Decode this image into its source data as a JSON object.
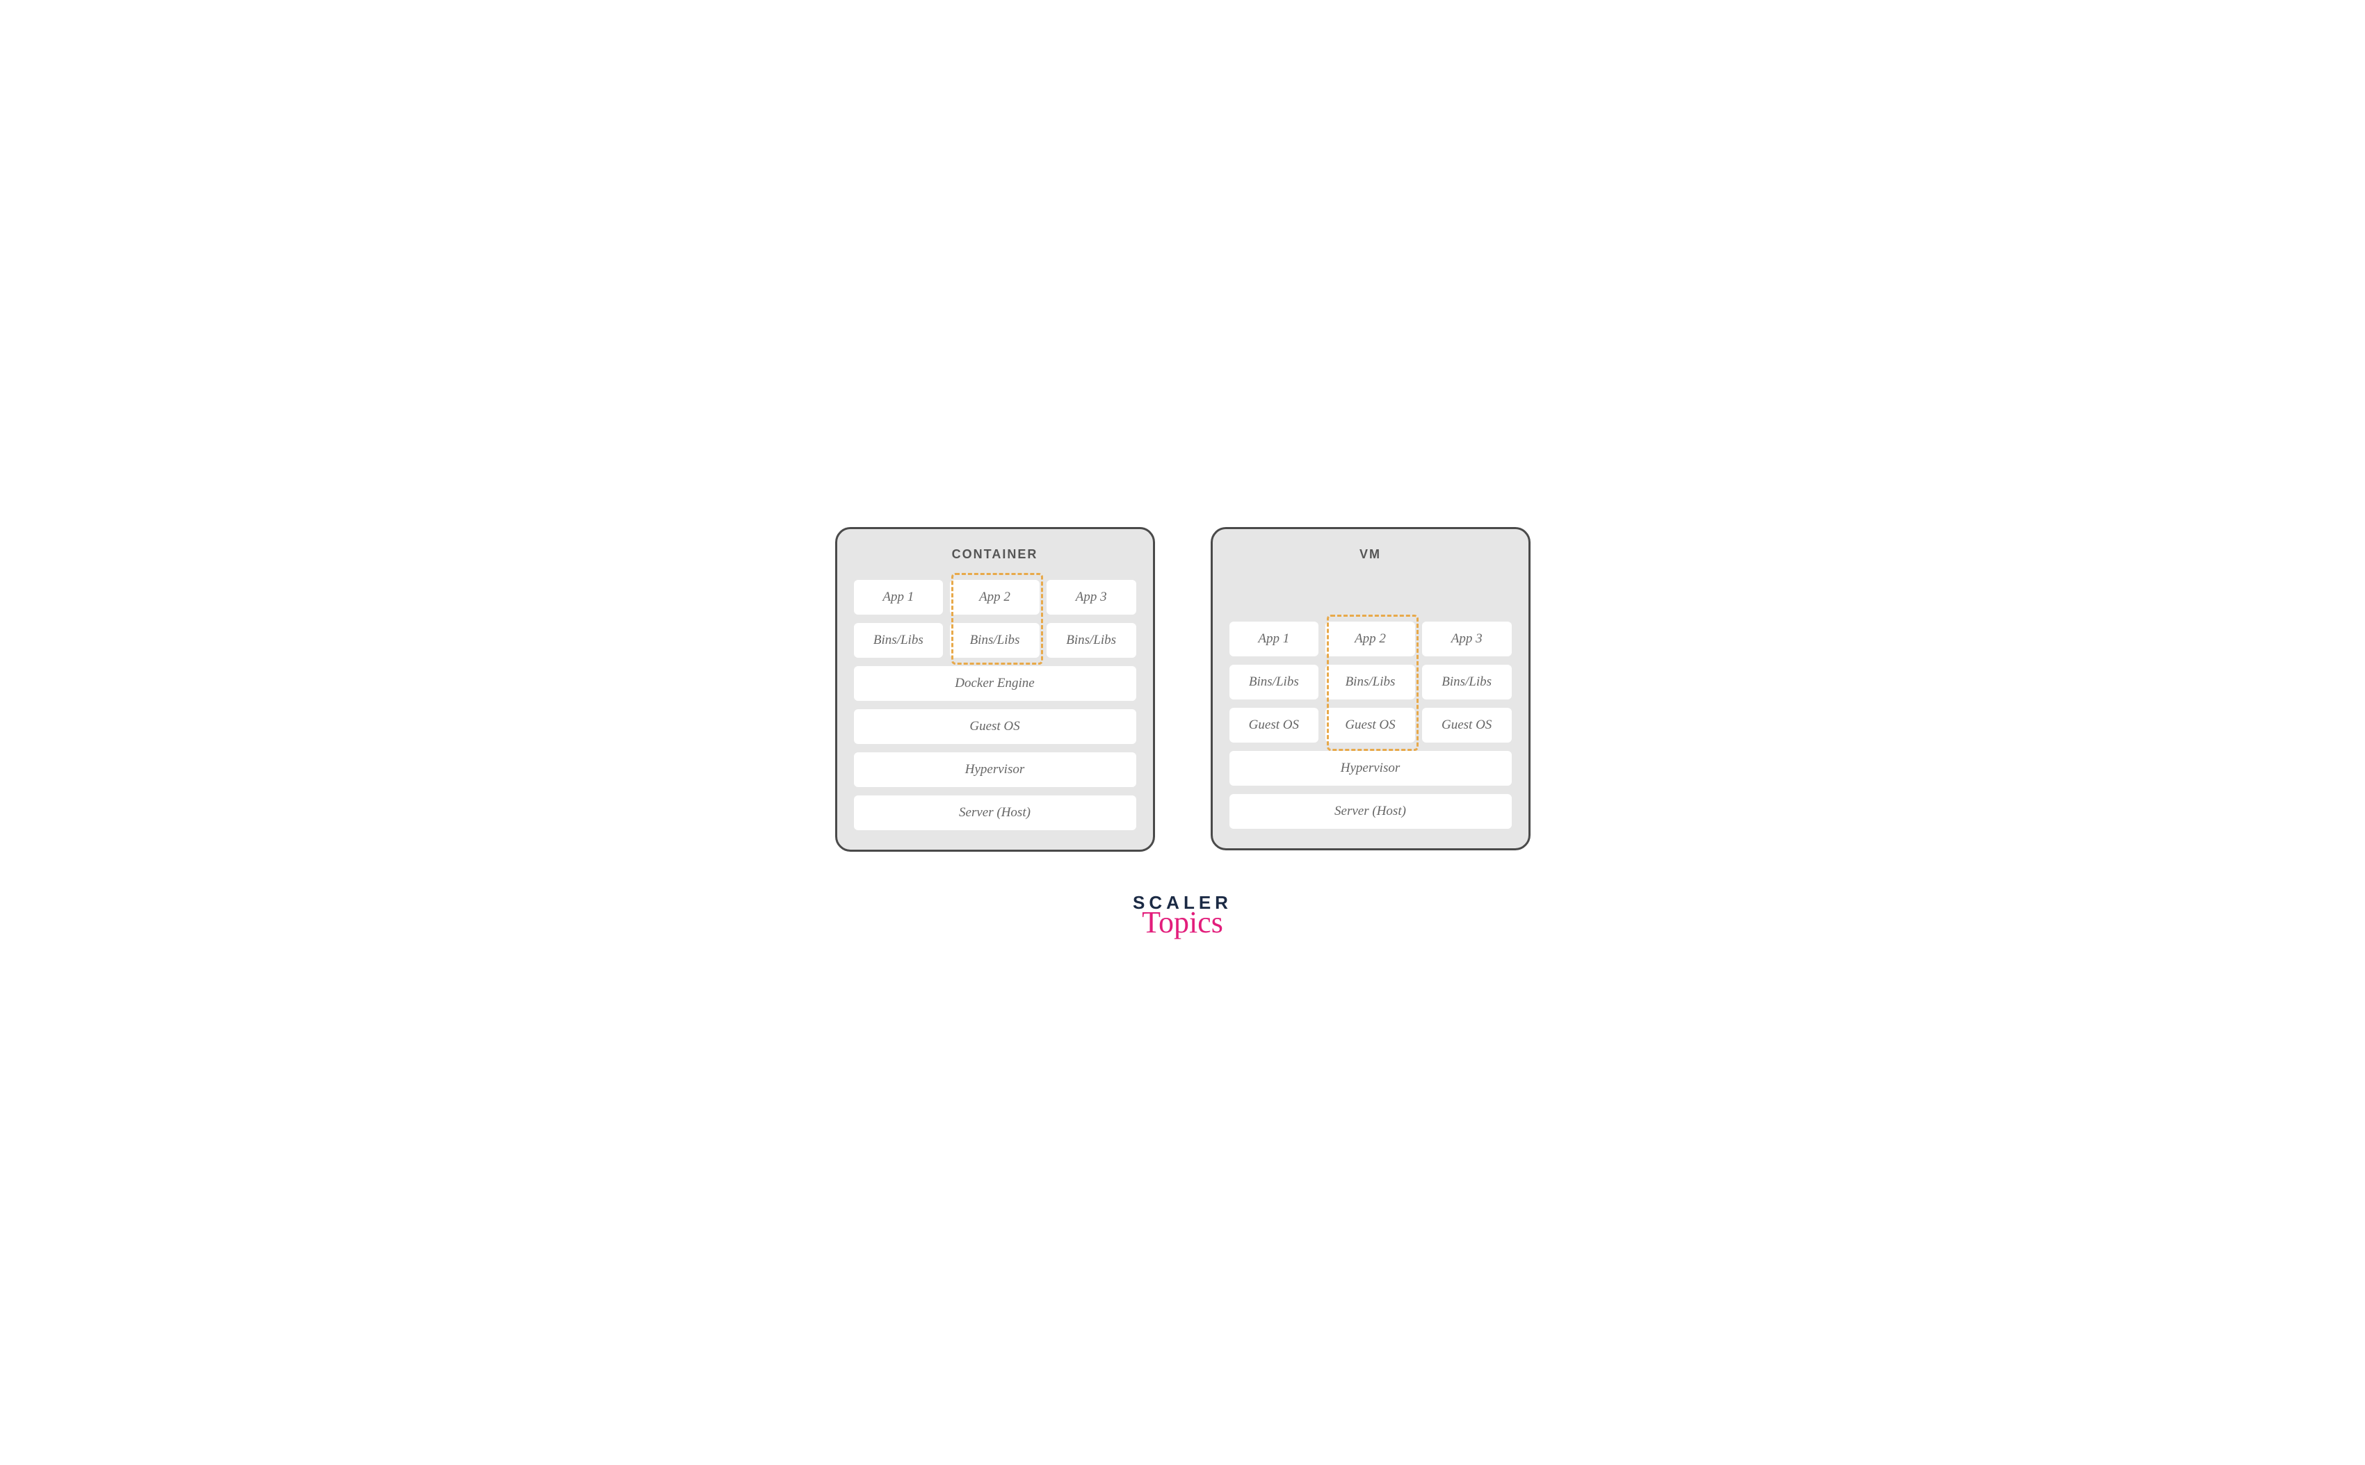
{
  "container": {
    "title": "CONTAINER",
    "apps": [
      "App 1",
      "App 2",
      "App 3"
    ],
    "bins": [
      "Bins/Libs",
      "Bins/Libs",
      "Bins/Libs"
    ],
    "layers": [
      "Docker Engine",
      "Guest OS",
      "Hypervisor",
      "Server (Host)"
    ]
  },
  "vm": {
    "title": "VM",
    "apps": [
      "App 1",
      "App 2",
      "App 3"
    ],
    "bins": [
      "Bins/Libs",
      "Bins/Libs",
      "Bins/Libs"
    ],
    "os": [
      "Guest OS",
      "Guest OS",
      "Guest OS"
    ],
    "layers": [
      "Hypervisor",
      "Server (Host)"
    ]
  },
  "brand": {
    "line1": "SCALER",
    "line2": "Topics"
  },
  "colors": {
    "highlight": "#e8a94a",
    "panelBg": "#e6e6e6",
    "panelBorder": "#4a4a4a",
    "cellBg": "#ffffff",
    "text": "#666",
    "brandDark": "#1b2a44",
    "brandPink": "#e21d7b"
  }
}
